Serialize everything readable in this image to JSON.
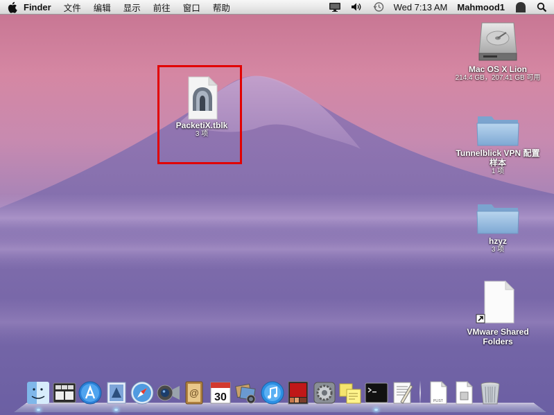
{
  "menubar": {
    "app_name": "Finder",
    "menus": [
      "文件",
      "编辑",
      "显示",
      "前往",
      "窗口",
      "帮助"
    ],
    "clock": "Wed 7:13 AM",
    "user": "Mahmood1"
  },
  "desktop_items": {
    "packetix": {
      "label": "PacketiX.tblk",
      "sub": "3 项"
    },
    "hdd": {
      "label": "Mac OS X Lion",
      "sub": "214.4 GB，207.41 GB 可用"
    },
    "tunnelblick": {
      "label": "Tunnelblick VPN 配置",
      "label2": "样本",
      "sub": "1 项"
    },
    "hzyz": {
      "label": "hzyz",
      "sub": "3 项"
    },
    "vmware": {
      "label": "VMware Shared",
      "label2": "Folders"
    }
  },
  "dock": {
    "apps": [
      "finder-icon",
      "mission-control-icon",
      "app-store-icon",
      "mail-icon",
      "safari-icon",
      "facetime-icon",
      "address-book-icon",
      "ical-icon",
      "photo-booth-icon",
      "itunes-icon",
      "photo-icon",
      "system-preferences-icon",
      "stickies-icon",
      "terminal-icon",
      "textedit-icon"
    ],
    "ical_day": "30",
    "plist_label": "PLIST"
  },
  "colors": {
    "highlight": "#e20000",
    "folder": "#8fb9df"
  }
}
